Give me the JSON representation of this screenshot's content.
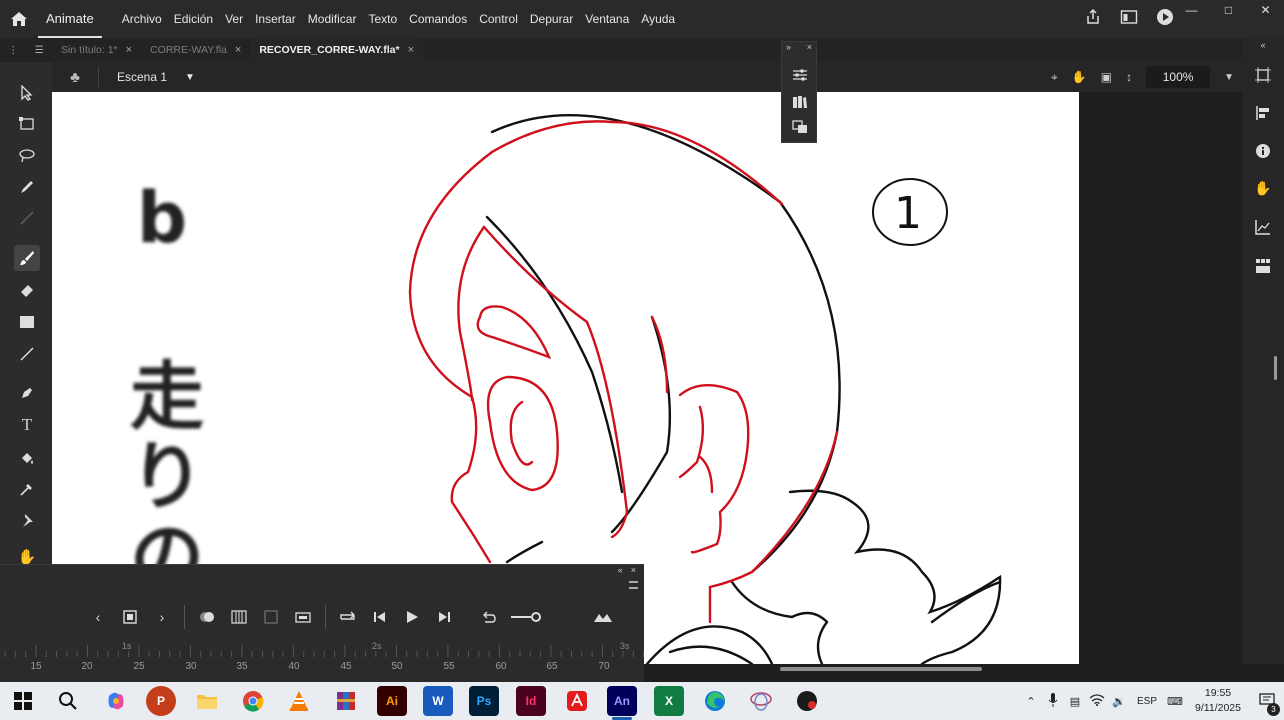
{
  "app": {
    "name": "Animate"
  },
  "menu": [
    "Archivo",
    "Edición",
    "Ver",
    "Insertar",
    "Modificar",
    "Texto",
    "Comandos",
    "Control",
    "Depurar",
    "Ventana",
    "Ayuda"
  ],
  "tabs": [
    {
      "label": "Sin título: 1*",
      "active": false
    },
    {
      "label": "CORRE-WAY.fla",
      "active": false
    },
    {
      "label": "RECOVER_CORRE-WAY.fla*",
      "active": true
    }
  ],
  "scene": {
    "name": "Escena 1"
  },
  "zoom": {
    "value": "100%"
  },
  "stage_text": {
    "letter": "b",
    "kanji": [
      "走",
      "り",
      "の"
    ],
    "circled_number": "1"
  },
  "timeline": {
    "second_labels": [
      "1s",
      "2s",
      "3s"
    ],
    "frame_labels": [
      "15",
      "20",
      "25",
      "30",
      "35",
      "40",
      "45",
      "50",
      "55",
      "60",
      "65",
      "70"
    ]
  },
  "taskbar": {
    "apps": [
      "windows-start",
      "search",
      "copilot",
      "powerpoint",
      "file-explorer",
      "chrome",
      "vlc",
      "winrar",
      "illustrator",
      "word",
      "photoshop",
      "indesign",
      "acrobat",
      "animate",
      "excel",
      "edge",
      "app-lasso",
      "app-dark"
    ],
    "app_labels": {
      "illustrator": "Ai",
      "photoshop": "Ps",
      "indesign": "Id",
      "animate": "An"
    },
    "language": "ESP",
    "time": "19:55",
    "date": "9/11/2025",
    "notification_count": "3"
  },
  "colors": {
    "accent_red": "#d0101c",
    "stage_bg": "#ffffff",
    "chrome_bg": "#2a2a2a"
  }
}
